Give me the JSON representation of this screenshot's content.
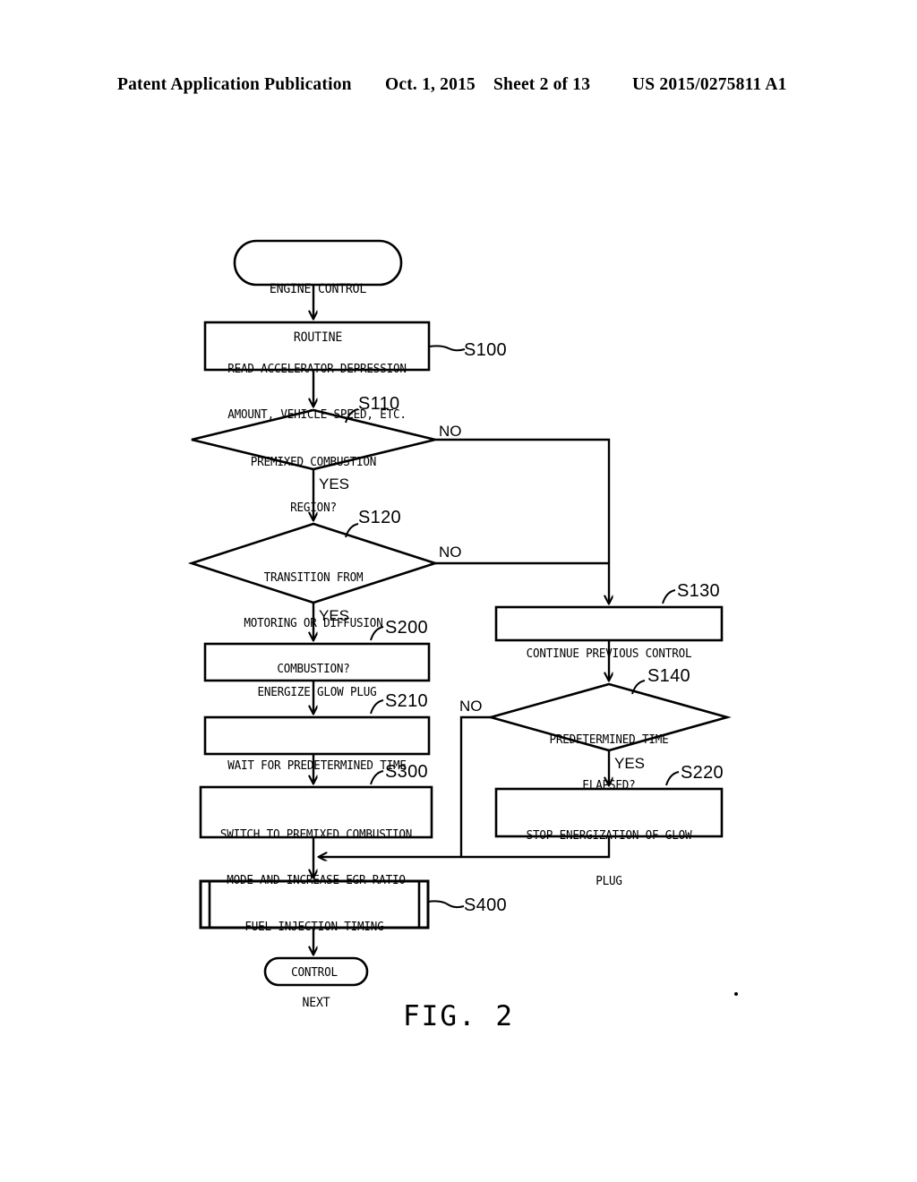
{
  "header": {
    "publication": "Patent Application Publication",
    "date": "Oct. 1, 2015",
    "sheet": "Sheet 2 of 13",
    "number": "US 2015/0275811 A1"
  },
  "figure": {
    "caption": "FIG.  2",
    "nodes": {
      "start": {
        "type": "terminator",
        "line1": "ENGINE CONTROL",
        "line2": "ROUTINE"
      },
      "s100": {
        "type": "process",
        "line1": "READ ACCELERATOR DEPRESSION",
        "line2": "AMOUNT, VEHICLE SPEED, ETC.",
        "step": "S100"
      },
      "s110": {
        "type": "decision",
        "line1": "PREMIXED COMBUSTION",
        "line2": "REGION?",
        "step": "S110",
        "yes": "YES",
        "no": "NO"
      },
      "s120": {
        "type": "decision",
        "line1": "TRANSITION FROM",
        "line2": "MOTORING OR DIFFUSION",
        "line3": "COMBUSTION?",
        "step": "S120",
        "yes": "YES",
        "no": "NO"
      },
      "s130": {
        "type": "process",
        "line1": "CONTINUE PREVIOUS CONTROL",
        "step": "S130"
      },
      "s140": {
        "type": "decision",
        "line1": "PREDETERMINED TIME",
        "line2": "ELAPSED?",
        "step": "S140",
        "yes": "YES",
        "no": "NO"
      },
      "s200": {
        "type": "process",
        "line1": "ENERGIZE GLOW PLUG",
        "step": "S200"
      },
      "s210": {
        "type": "process",
        "line1": "WAIT FOR PREDETERMINED TIME",
        "step": "S210"
      },
      "s220": {
        "type": "process",
        "line1": "STOP ENERGIZATION OF GLOW",
        "line2": "PLUG",
        "step": "S220"
      },
      "s300": {
        "type": "process",
        "line1": "SWITCH TO PREMIXED COMBUSTION",
        "line2": "MODE AND INCREASE EGR RATIO",
        "step": "S300"
      },
      "s400": {
        "type": "predefined-process",
        "line1": "FUEL INJECTION TIMING",
        "line2": "CONTROL",
        "step": "S400"
      },
      "end": {
        "type": "terminator",
        "line1": "NEXT"
      }
    }
  },
  "colors": {
    "ink": "#000000",
    "paper": "#ffffff"
  }
}
